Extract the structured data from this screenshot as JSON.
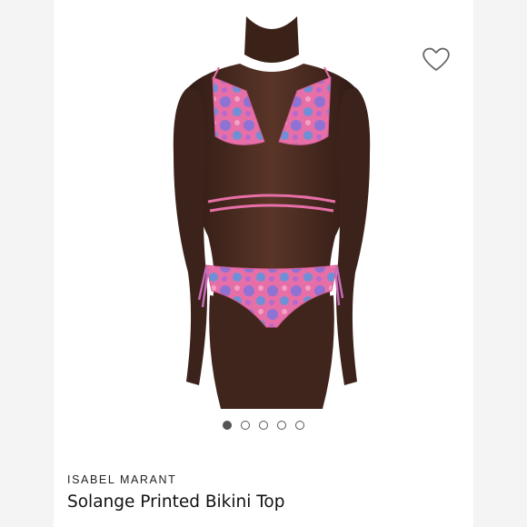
{
  "carousel": {
    "slides": 5,
    "active_index": 0
  },
  "wishlist": {
    "icon": "heart-outline-icon"
  },
  "product": {
    "brand": "ISABEL MARANT",
    "title": "Solange Printed Bikini Top"
  },
  "colors": {
    "page_bg": "#f4f4f4",
    "card_bg": "#ffffff",
    "skin": "#4a2c22",
    "print_pink": "#e66fa6",
    "print_purple": "#8a6fd0",
    "text": "#111111"
  }
}
